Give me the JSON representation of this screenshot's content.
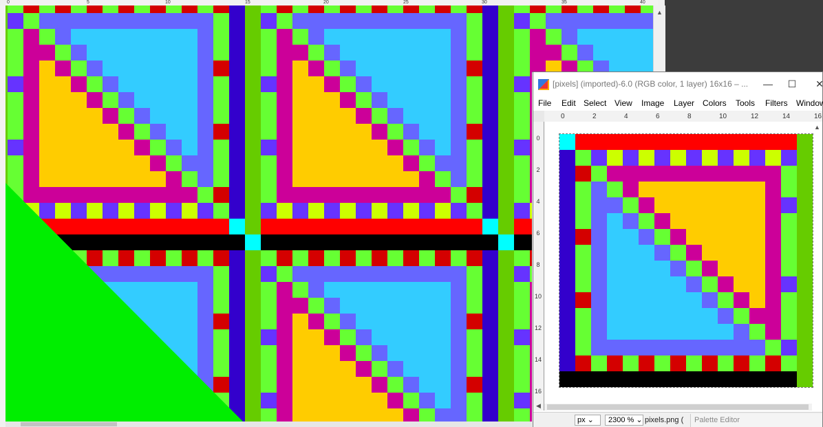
{
  "background_window": {
    "ruler_top_labels": [
      "0",
      "5",
      "10",
      "15",
      "20",
      "25",
      "30",
      "35",
      "40"
    ]
  },
  "front_window": {
    "title": "[pixels] (imported)-6.0 (RGB color, 1 layer) 16x16 – ...",
    "buttons": {
      "minimize": "—",
      "maximize": "☐",
      "close": "✕"
    },
    "menu": [
      "File",
      "Edit",
      "Select",
      "View",
      "Image",
      "Layer",
      "Colors",
      "Tools",
      "Filters",
      "Windows"
    ],
    "ruler_top_labels": [
      "0",
      "2",
      "4",
      "6",
      "8",
      "10",
      "12",
      "14",
      "16"
    ],
    "ruler_left_labels": [
      "0",
      "2",
      "4",
      "6",
      "8",
      "10",
      "12",
      "14",
      "16"
    ],
    "status": {
      "unit": "px",
      "zoom": "2300 %",
      "filename": "pixels.png (",
      "palette_tab": "Palette Editor"
    }
  },
  "sprite": {
    "size": 16,
    "palette": {
      "K": "#000000",
      "C": "#00ffff",
      "R": "#ff0000",
      "r": "#d40000",
      "L": "#66ff33",
      "Y": "#ccff00",
      "P": "#6633ff",
      "B": "#3300cc",
      "M": "#cc0099",
      "O": "#ffcc00",
      "S": "#33ccff",
      "V": "#6666ff",
      "g": "#66cc00"
    },
    "rows": [
      "CRRRRRRRRRRRRRRg",
      "BLPYPYPYPYPYPYPg",
      "BrLMMMMMMMMMMMLg",
      "BLVLMOOOOOOOOMLg",
      "BLVVLMOOOOOOOMPg",
      "BLVSVLMOOOOOOMLg",
      "BrVSSVLMOOOOOMLg",
      "BLVSSSVLMOOOOMLg",
      "BLVSSSSVLMOOOMLg",
      "BLVSSSSSVLMOOMPg",
      "BrVSSSSSSVLMOMLg",
      "BLVSSSSSSSVLMMLg",
      "BLVSSSSSSSSVLMLg",
      "BLVVVVVVVVVVVLPg",
      "BrLrLrLrLrLrLrLg",
      "KKKKKKKKKKKKKKKg"
    ]
  },
  "tile_view": {
    "tile_rows": [
      "CKKKKKKKKKKKKKKK",
      "gLrLrLrLrLrLrLrB",
      "gPLVVVVVVVVVVVLB",
      "gLMLVSSSSSSSSVLB",
      "gLMMLVSSSSSSSVLB",
      "gLMOMLVSSSSSSVrB",
      "gPMOOMLVSSSSSVLB",
      "gLMOOOMLVSSSSVLB",
      "gLMOOOOMLVSSSVLB",
      "gLMOOOOOMLVSSVrB",
      "gPMOOOOOOMLVSVLB",
      "gLMOOOOOOOMLVVLB",
      "gLMOOOOOOOOMLVLB",
      "gLMMMMMMMMMMMLrB",
      "gPYPYPYPYPYPYPLB",
      "gRRRRRRRRRRRRRRC"
    ],
    "green_fill": "#00ee00"
  }
}
